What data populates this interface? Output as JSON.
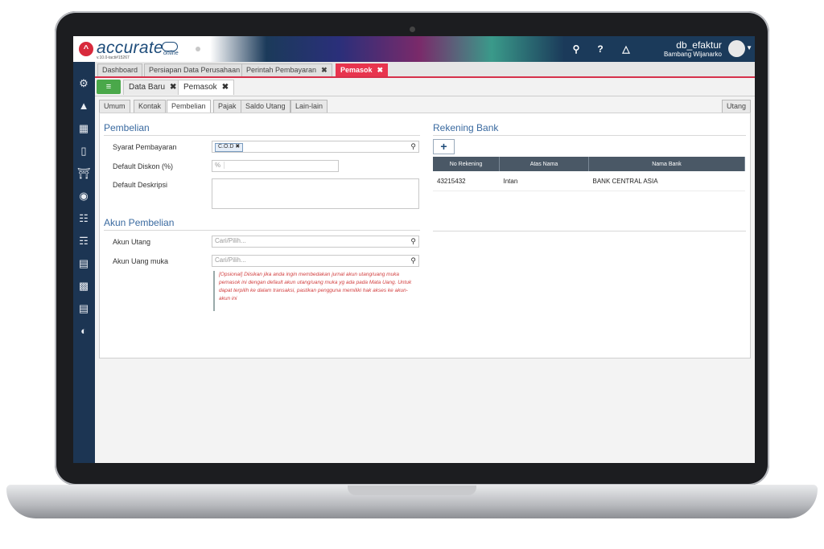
{
  "app": {
    "logo_text": "accurate",
    "logo_sub": "online",
    "version": "v.10.0-tacti#15267",
    "db_name": "db_efaktur",
    "user_name": "Bambang Wijanarko"
  },
  "top_icons": [
    "search-icon",
    "help-icon",
    "bell-icon"
  ],
  "sidebar_icons": [
    "gear-icon",
    "building-icon",
    "ledger-icon",
    "card-icon",
    "bank-icon",
    "bag-icon",
    "cart-icon",
    "truck-cart-icon",
    "factory-icon",
    "register-icon",
    "report-icon",
    "chart-icon"
  ],
  "main_tabs": [
    {
      "label": "Dashboard",
      "closable": false,
      "active": false
    },
    {
      "label": "Persiapan Data Perusahaan",
      "closable": false,
      "active": false
    },
    {
      "label": "Perintah Pembayaran",
      "closable": true,
      "active": false
    },
    {
      "label": "Pemasok",
      "closable": true,
      "active": true
    }
  ],
  "sub_tabs": [
    {
      "label": "Data Baru",
      "closable": true,
      "active": false
    },
    {
      "label": "Pemasok",
      "closable": true,
      "active": true
    }
  ],
  "form_tabs": [
    "Umum",
    "Kontak",
    "Pembelian",
    "Pajak",
    "Saldo Utang",
    "Lain-lain"
  ],
  "form_tab_active": "Pembelian",
  "right_tab": "Utang",
  "pembelian": {
    "title": "Pembelian",
    "syarat_label": "Syarat Pembayaran",
    "syarat_value": "C.O.D",
    "diskon_label": "Default Diskon (%)",
    "diskon_suffix": "%",
    "deskripsi_label": "Default Deskripsi"
  },
  "akun": {
    "title": "Akun Pembelian",
    "utang_label": "Akun Utang",
    "utang_placeholder": "Cari/Pilih...",
    "uangmuka_label": "Akun Uang muka",
    "uangmuka_placeholder": "Cari/Pilih...",
    "note": "[Opsional] Diisikan jika anda ingin membedakan jurnal akun utang/uang muka pemasok ini dengan default akun utang/uang muka yg ada pada Mata Uang. Untuk dapat terpilih ke dalam transaksi, pastikan pengguna memiliki hak akses ke akun-akun ini"
  },
  "rekening": {
    "title": "Rekening Bank",
    "add_label": "+",
    "columns": [
      "No Rekening",
      "Atas Nama",
      "Nama Bank"
    ],
    "rows": [
      [
        "43215432",
        "Intan",
        "BANK CENTRAL ASIA"
      ]
    ]
  }
}
